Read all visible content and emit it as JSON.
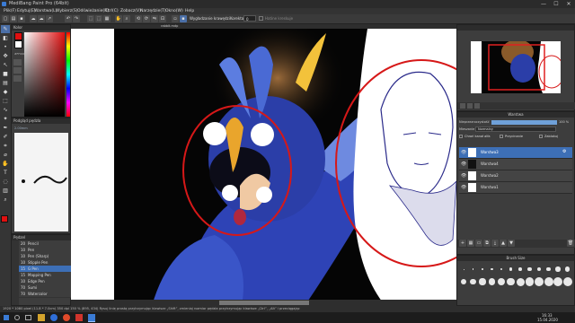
{
  "app": {
    "title": "MediBang Paint Pro (64bit)"
  },
  "window_controls": {
    "minimize": "—",
    "maximize": "☐",
    "close": "✕"
  },
  "menu": [
    "Plik(F)",
    "Edytuj(E)",
    "Warstwa(L)",
    "Wybierz(S)",
    "Odświeżanie(R)",
    "Ctrl(C)",
    "Zobacz(V)",
    "Narzędzie(T)",
    "Okno(W)",
    "Help"
  ],
  "toolbar": {
    "stabilizer_label": "Wygładzanie krawędzi",
    "correction_label": "Korekta",
    "correction_value": "0",
    "hatch_label": "Hatine kreskuje"
  },
  "color_panel": {
    "title": "Kolor",
    "hex": "#FF0000",
    "primary": "#e01010",
    "secondary": "#ffffff"
  },
  "brush_preview_panel": {
    "title": "Podgląd pędzla",
    "size_text": "2.00mm"
  },
  "canvas_tab": {
    "title": "rabbit.mdp"
  },
  "brush_panel": {
    "title": "Pędzel",
    "items": [
      {
        "size": "20",
        "name": "Pencil"
      },
      {
        "size": "10",
        "name": "Pen"
      },
      {
        "size": "10",
        "name": "Pen (Sharp)"
      },
      {
        "size": "10",
        "name": "Stipple Pen"
      },
      {
        "size": "15",
        "name": "G Pen"
      },
      {
        "size": "15",
        "name": "Mapping Pen"
      },
      {
        "size": "10",
        "name": "Edge Pen"
      },
      {
        "size": "70",
        "name": "Sumi"
      },
      {
        "size": "70",
        "name": "Watercolor"
      }
    ],
    "selected_index": 4
  },
  "layer_panel": {
    "title": "Warstwa",
    "opacity_label": "Nieprzezroczystość",
    "opacity_value": "100 %",
    "blend_label": "Mieszanie",
    "blend_value": "Normalny",
    "protect_alpha": "Chroń kanał alfa",
    "clipping": "Przycinanie",
    "lock": "Zablokuj",
    "layers": [
      "Warstwa3",
      "Warstwa4",
      "Warstwa2",
      "Warstwa1"
    ],
    "selected": 0
  },
  "brush_size_panel": {
    "title": "Brush Size"
  },
  "statusbar": {
    "text": "1920 * 1080 pixel   (11.8 * 7.0cm)  350 dpi   150 %   (895, 434)   Rysuj linię prostą przytrzymując klawisze „Shift”, zmieniaj rozmiar pędzla przytrzymując klawisze „Ctrl”, „Alt” i przeciągając"
  },
  "taskbar": {
    "time": "16:33",
    "date": "15.04.2020"
  }
}
